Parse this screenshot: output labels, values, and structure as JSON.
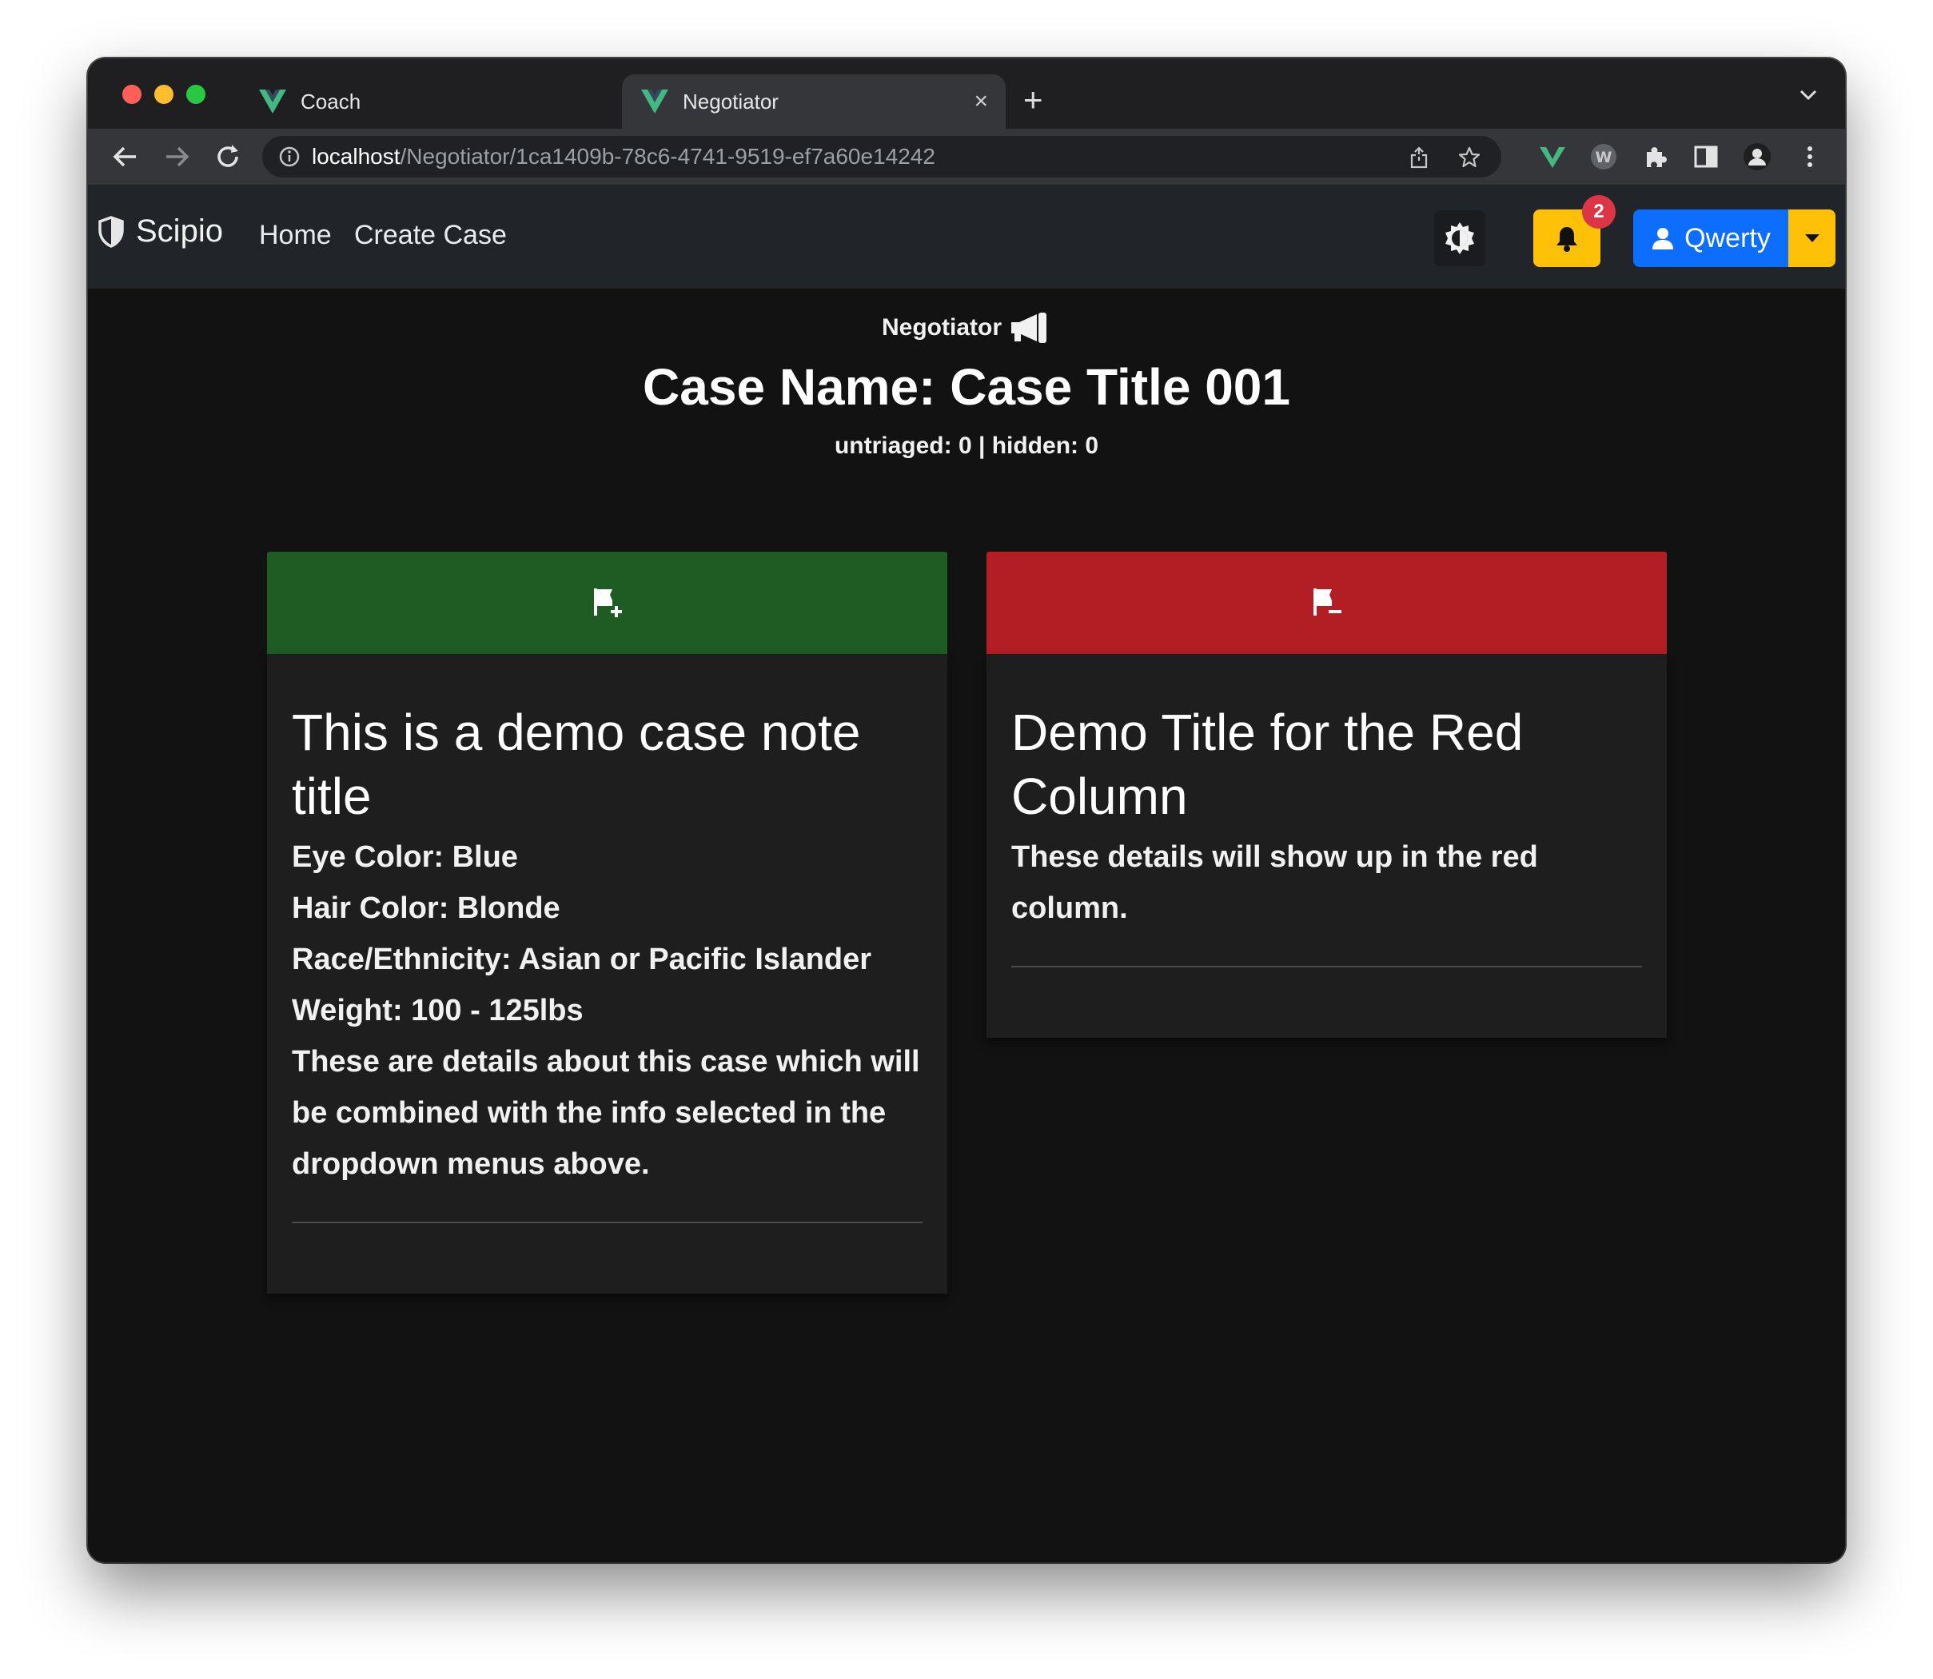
{
  "browser": {
    "tabs": [
      {
        "title": "Coach",
        "close": "×"
      },
      {
        "title": "Negotiator",
        "close": "×"
      }
    ],
    "new_tab": "+",
    "url_host": "localhost",
    "url_path": "/Negotiator/1ca1409b-78c6-4741-9519-ef7a60e14242"
  },
  "navbar": {
    "brand": "Scipio",
    "links": [
      "Home",
      "Create Case"
    ],
    "notification_count": "2",
    "user_label": "Qwerty"
  },
  "page": {
    "role_label": "Negotiator",
    "case_title": "Case Name: Case Title 001",
    "counts": "untriaged: 0 | hidden: 0"
  },
  "columns": {
    "green": {
      "header_icon": "flag-plus-icon",
      "color": "#1f5c24",
      "card": {
        "title": "This is a demo case note title",
        "lines": [
          "Eye Color: Blue",
          "Hair Color: Blonde",
          "Race/Ethnicity: Asian or Pacific Islander",
          "Weight: 100 - 125lbs",
          "These are details about this case which will be combined with the info selected in the dropdown menus above."
        ]
      }
    },
    "red": {
      "header_icon": "flag-minus-icon",
      "color": "#b31e25",
      "card": {
        "title": "Demo Title for the Red Column",
        "lines": [
          "These details will show up in the red column."
        ]
      }
    }
  }
}
